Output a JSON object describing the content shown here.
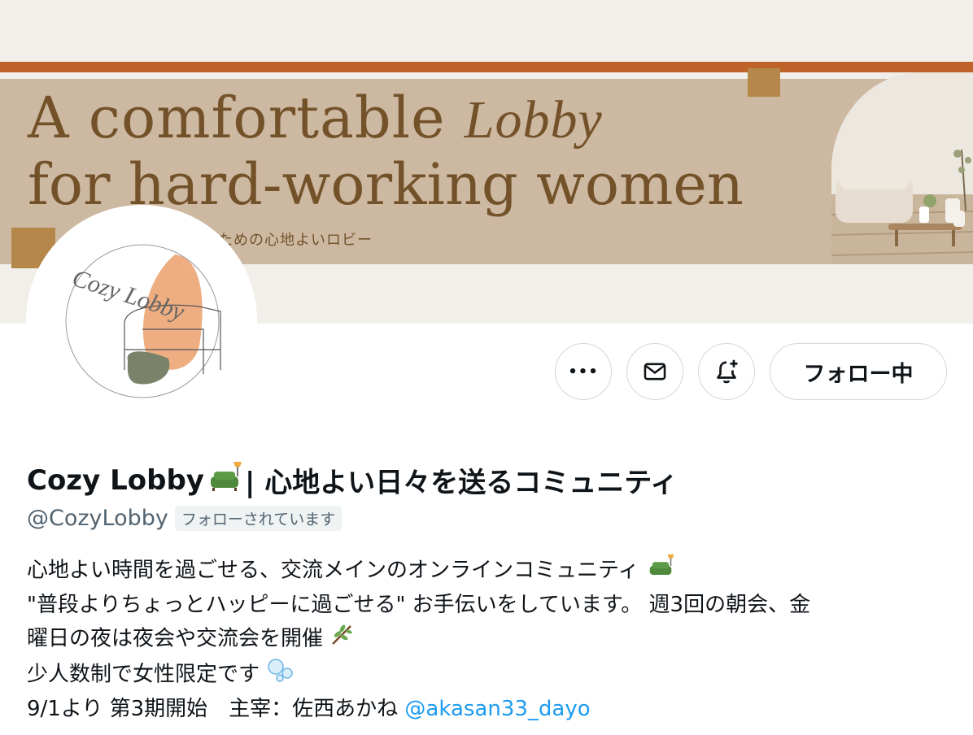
{
  "banner": {
    "headline_part1": "A comfortable",
    "headline_script": "Lobby",
    "headline_line2": "for hard-working women",
    "subtitle_jp": "ための心地よいロビー"
  },
  "avatar": {
    "logo_text": "Cozy Lobby"
  },
  "actions": {
    "more_label": "•••",
    "follow_label": "フォロー中"
  },
  "profile": {
    "name": "Cozy Lobby",
    "name_suffix": "| 心地よい日々を送るコミュニティ",
    "handle": "@CozyLobby",
    "follows_you": "フォローされています"
  },
  "bio": {
    "line1": "心地よい時間を過ごせる、交流メインのオンラインコミュニティ",
    "line2": "\"普段よりちょっとハッピーに過ごせる\" お手伝いをしています。 週3回の朝会、金",
    "line3": "曜日の夜は夜会や交流会を開催",
    "line4": "少人数制で女性限定です",
    "line5_text": "9/1より 第3期開始　主宰：佐西あかね ",
    "line5_mention": "@akasan33_dayo"
  },
  "colors": {
    "stripe": "#c0632a",
    "band": "#cdb8a1",
    "headline": "#73522a",
    "link": "#1d9bf0"
  }
}
